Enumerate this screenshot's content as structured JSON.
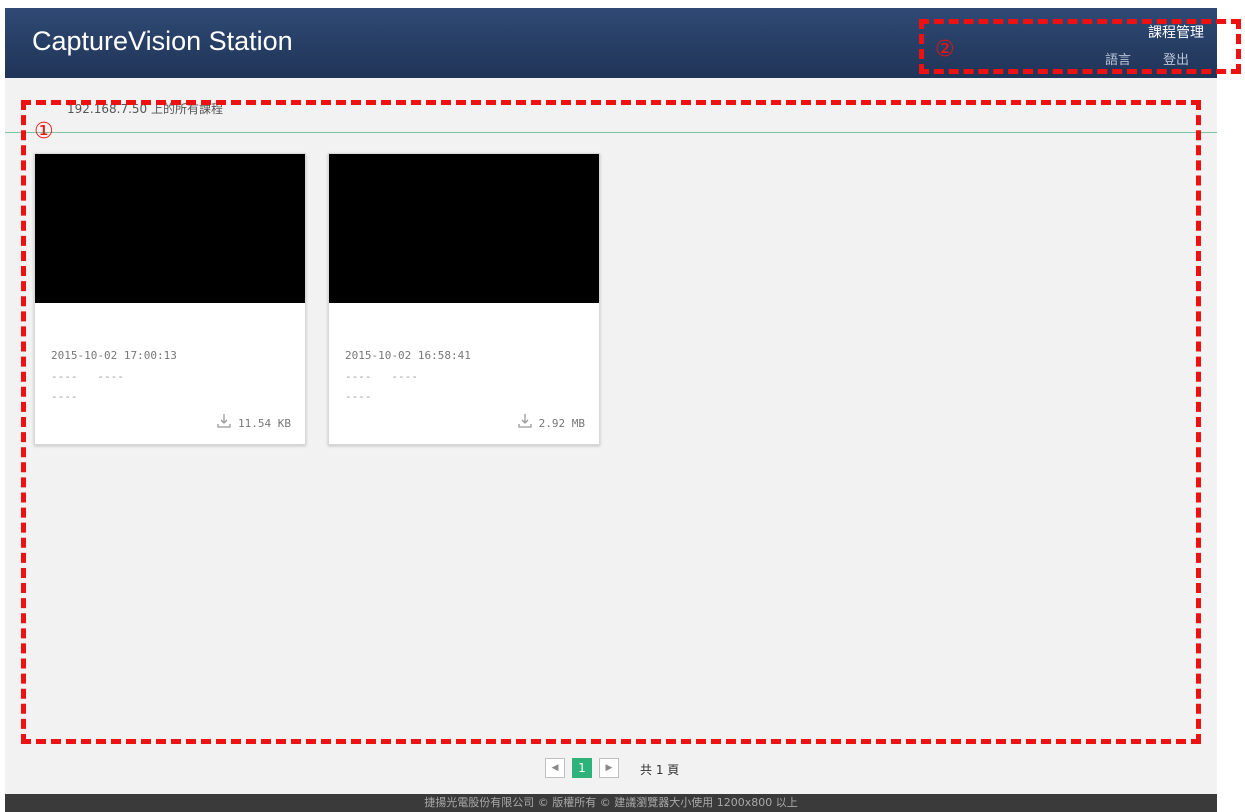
{
  "header": {
    "title": "CaptureVision Station",
    "nav_main": "課程管理",
    "nav_language": "語言",
    "nav_logout": "登出"
  },
  "breadcrumb": "192.168.7.50 上的所有課程",
  "annotations": {
    "marker_1": "①",
    "marker_2": "②"
  },
  "courses": [
    {
      "timestamp": "2015-10-02 17:00:13",
      "line1": "----   ----",
      "line2": "----",
      "size": "11.54 KB",
      "icon": "download-icon"
    },
    {
      "timestamp": "2015-10-02 16:58:41",
      "line1": "----   ----",
      "line2": "----",
      "size": "2.92 MB",
      "icon": "download-icon"
    }
  ],
  "pagination": {
    "prev_icon": "prev-page-icon",
    "current_page": "1",
    "next_icon": "next-page-icon",
    "total_label": "共 1 頁"
  },
  "footer": {
    "text": "捷揚光電股份有限公司 © 版權所有 © 建議瀏覽器大小使用 1200x800 以上"
  },
  "colors": {
    "header": "#2a4066",
    "accent": "#2db37a",
    "annotation": "#ee1111",
    "footer": "#3a3a3a"
  }
}
